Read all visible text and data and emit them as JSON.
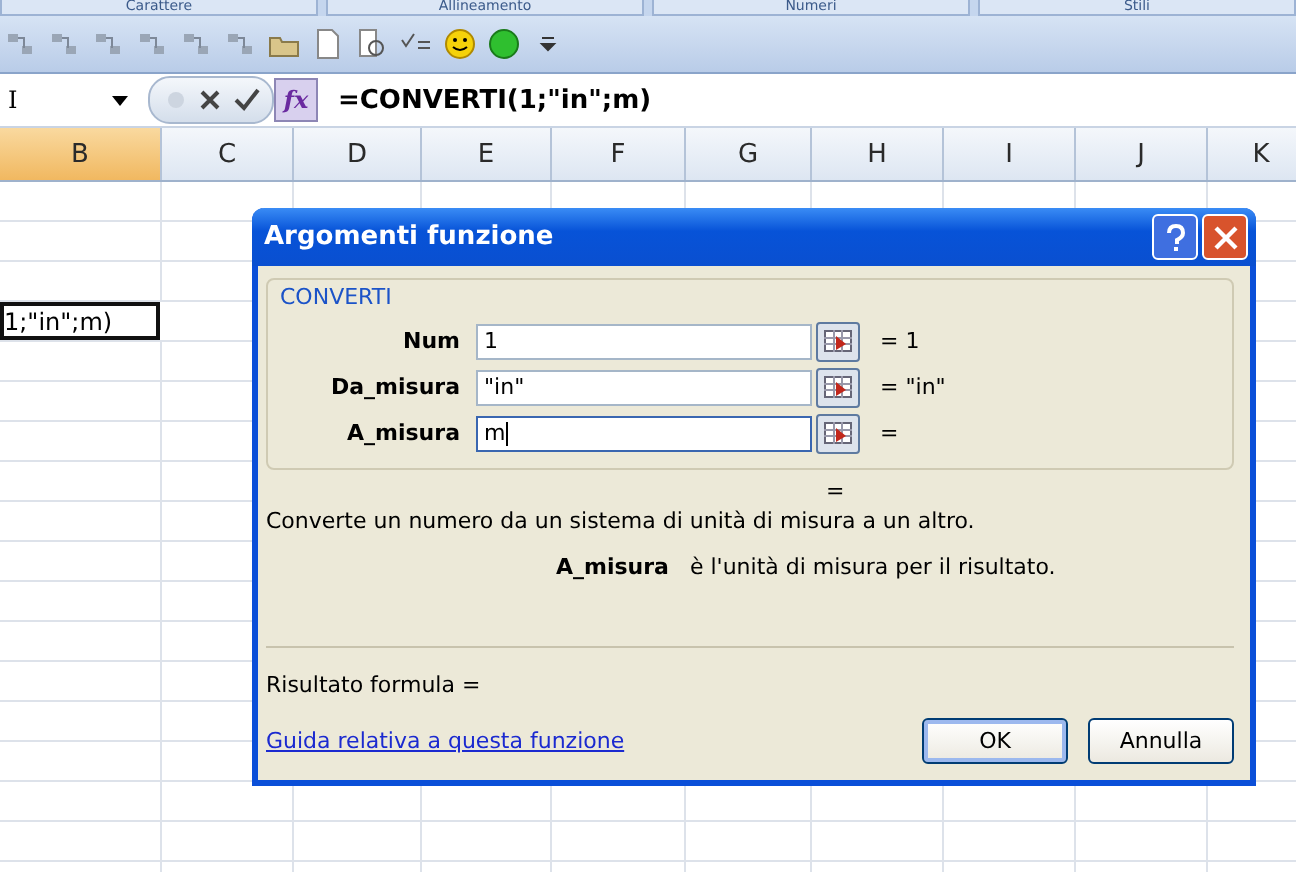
{
  "ribbon_groups": [
    "Carattere",
    "Allineamento",
    "Numeri",
    "Stili"
  ],
  "name_box": {
    "value": "I"
  },
  "formula_bar": {
    "function_button": "fx",
    "value": "=CONVERTI(1;\"in\";m)"
  },
  "columns": [
    {
      "label": "B",
      "selected": true
    },
    {
      "label": "C",
      "selected": false
    },
    {
      "label": "D",
      "selected": false
    },
    {
      "label": "E",
      "selected": false
    },
    {
      "label": "F",
      "selected": false
    },
    {
      "label": "G",
      "selected": false
    },
    {
      "label": "H",
      "selected": false
    },
    {
      "label": "I",
      "selected": false
    },
    {
      "label": "J",
      "selected": false
    },
    {
      "label": "K",
      "selected": false
    }
  ],
  "active_cell": {
    "value": "1;\"in\";m)"
  },
  "dialog": {
    "title": "Argomenti funzione",
    "function_name": "CONVERTI",
    "arguments": [
      {
        "label": "Num",
        "value": "1",
        "result": "= 1",
        "focused": false
      },
      {
        "label": "Da_misura",
        "value": "\"in\"",
        "result": "= \"in\"",
        "focused": false
      },
      {
        "label": "A_misura",
        "value": "m",
        "result": "=",
        "focused": true
      }
    ],
    "result_equals": "=",
    "description": "Converte un numero da un sistema di unità di misura a un altro.",
    "argument_help": {
      "name": "A_misura",
      "text": "è l'unità di misura per il risultato."
    },
    "formula_result": "Risultato formula =",
    "help_link": "Guida relativa a questa funzione",
    "buttons": [
      {
        "label": "OK",
        "default": true
      },
      {
        "label": "Annulla",
        "default": false
      }
    ]
  }
}
